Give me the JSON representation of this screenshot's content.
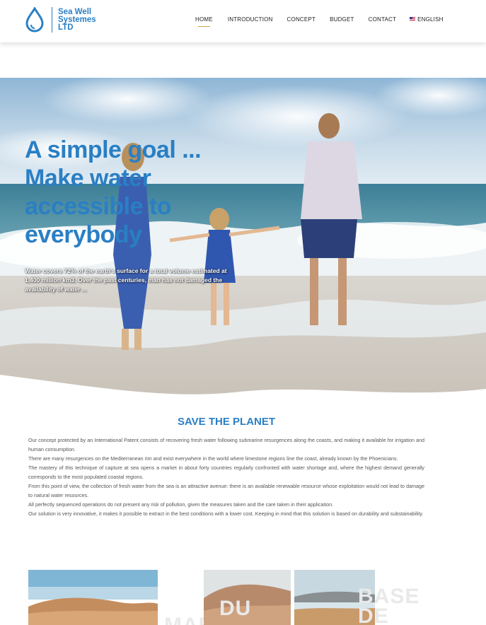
{
  "logo": {
    "icon": "water-drop-icon",
    "line1": "Sea Well",
    "line2": "Systemes",
    "line3": "LTD"
  },
  "nav": {
    "items": [
      {
        "label": "HOME",
        "active": true
      },
      {
        "label": "INTRODUCTION"
      },
      {
        "label": "CONCEPT"
      },
      {
        "label": "BUDGET"
      },
      {
        "label": "CONTACT"
      },
      {
        "label": "ENGLISH",
        "icon": "uk-flag-icon"
      }
    ]
  },
  "hero": {
    "title_line1": "A simple goal ...",
    "title_line2": "Make water",
    "title_line3": "accessible to",
    "title_line4": "everybody",
    "text": "Water covers 72% of the earth's surface for a total volume estimated at 1,400 million km3. Over the past centuries, man has not damaged the availability of water ..."
  },
  "section": {
    "title": "SAVE THE PLANET",
    "paragraphs": [
      "Our concept protected by an International Patent consists of recovering fresh water following submarine resurgences along the coasts, and making it available for irrigation and human consumption.",
      "There are many resurgences on the Mediterranean rim and exist everywhere in the world where limestone regions line the coast, already known by the Phoenicians.",
      "The mastery of this technique of capture at sea opens a market in about forty countries regularly confronted with water shortage and, where the highest demand generally corresponds to the most populated coastal regions.",
      "From this point of view, the collection of fresh water from the sea is an attractive avenue: there is an available renewable resource whose exploitation would not lead to damage to natural water resources.",
      "All perfectly sequenced operations do not present any risk of pollution, given the measures taken and the care taken in their application.",
      "Our solution is very innovative, it makes it possible to extract in the best conditions with a lower cost. Keeping in mind  that this solution is based on durability and substainability."
    ]
  },
  "cards": {
    "word1": "MAROC",
    "word2": "DU",
    "word3a": "BASE",
    "word3b": "DE"
  },
  "colors": {
    "brand": "#2a7fc4",
    "accent": "#d7a14a"
  }
}
